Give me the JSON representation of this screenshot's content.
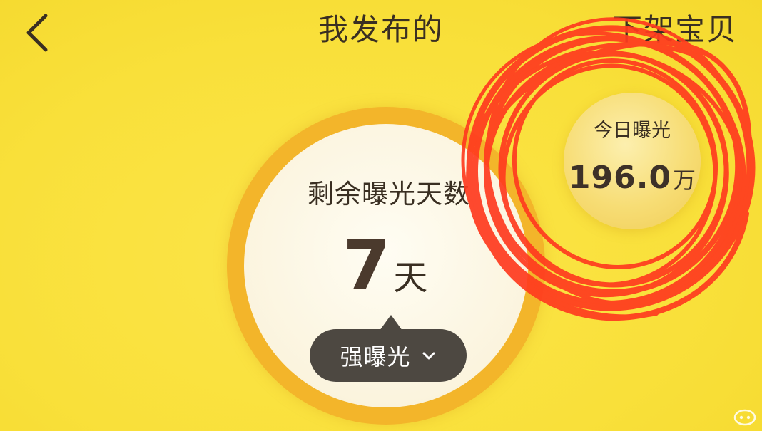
{
  "header": {
    "title": "我发布的",
    "action_label": "下架宝贝"
  },
  "exposure": {
    "days_label": "剩余曝光天数",
    "days_value": "7",
    "days_unit": "天",
    "mode_label": "强曝光"
  },
  "today": {
    "label": "今日曝光",
    "value": "196.0",
    "unit": "万"
  },
  "icons": {
    "back": "chevron-left-icon",
    "dropdown": "chevron-down-icon"
  },
  "colors": {
    "background": "#f9e03a",
    "ring": "#f3b52a",
    "pill": "#4d4841",
    "annotation": "#ff3b1f"
  }
}
